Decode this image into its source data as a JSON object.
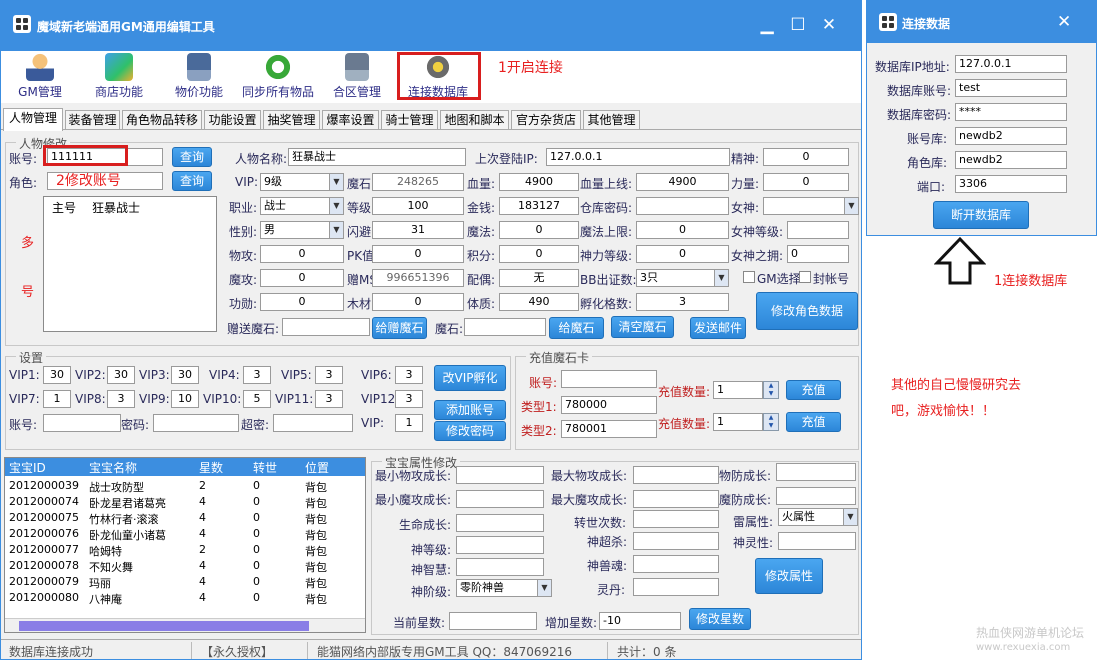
{
  "main_window": {
    "title": "魔域新老端通用GM通用编辑工具",
    "minimize": "▁",
    "maximize": "☐",
    "close": "✕"
  },
  "toolbar": {
    "items": [
      {
        "label": "GM管理",
        "icon": "gm-user-icon"
      },
      {
        "label": "商店功能",
        "icon": "shop-icon"
      },
      {
        "label": "物价功能",
        "icon": "price-icon"
      },
      {
        "label": "同步所有物品",
        "icon": "sync-icon"
      },
      {
        "label": "合区管理",
        "icon": "server-merge-icon"
      },
      {
        "label": "连接数据库",
        "icon": "database-connect-icon"
      }
    ],
    "annotation_open": "1开启连接"
  },
  "tabs": [
    "人物管理",
    "装备管理",
    "角色物品转移",
    "功能设置",
    "抽奖管理",
    "爆率设置",
    "骑士管理",
    "地图和脚本",
    "官方杂货店",
    "其他管理"
  ],
  "character": {
    "group_title": "人物修改",
    "account_label": "账号:",
    "account_value": "111111",
    "query1": "查询",
    "role_label": "角色:",
    "query2": "查询",
    "annotation_account": "2修改账号",
    "multi_label_1": "多",
    "multi_label_2": "号",
    "list_header_main": "主号",
    "list_header_name": "狂暴战士",
    "fields": {
      "name_label": "人物名称:",
      "name_value": "狂暴战士",
      "lastip_label": "上次登陆IP:",
      "lastip_value": "127.0.0.1",
      "spirit_label": "精神:",
      "spirit_value": "0",
      "vip_label": "VIP:",
      "vip_value": "9级",
      "magicstone_label": "魔石:",
      "magicstone_value": "248265",
      "hp_label": "血量:",
      "hp_value": "4900",
      "hpmax_label": "血量上线:",
      "hpmax_value": "4900",
      "power_label": "力量:",
      "power_value": "0",
      "job_label": "职业:",
      "job_value": "战士",
      "level_label": "等级:",
      "level_value": "100",
      "gold_label": "金钱:",
      "gold_value": "183127",
      "warehouse_label": "仓库密码:",
      "warehouse_value": "",
      "goddess_label": "女神:",
      "goddess_value": "",
      "gender_label": "性别:",
      "gender_value": "男",
      "dodge_label": "闪避:",
      "dodge_value": "31",
      "mana_label": "魔法:",
      "mana_value": "0",
      "manamax_label": "魔法上限:",
      "manamax_value": "0",
      "goddesslv_label": "女神等级:",
      "goddesslv_value": "",
      "pdef_label": "物攻:",
      "pdef_value": "0",
      "pk_label": "PK值:",
      "pk_value": "0",
      "points_label": "积分:",
      "points_value": "0",
      "godpower_label": "神力等级:",
      "godpower_value": "0",
      "goddesshug_label": "女神之拥:",
      "goddesshug_value": "0",
      "mattack_label": "魔攻:",
      "mattack_value": "0",
      "giftms_label": "赠MS:",
      "giftms_value": "996651396",
      "spouse_label": "配偶:",
      "spouse_value": "无",
      "bbcert_label": "BB出证数:",
      "bbcert_value": "3只",
      "gm_select": "GM选择",
      "ban_account": "封帐号",
      "merit_label": "功勋:",
      "merit_value": "0",
      "wood_label": "木材:",
      "wood_value": "0",
      "physique_label": "体质:",
      "physique_value": "490",
      "hatch_label": "孵化格数:",
      "hatch_value": "3",
      "modify_role": "修改角色数据",
      "gift_ms_label": "赠送魔石:",
      "gift_ms_value": "",
      "give_gift_ms": "给赠魔石",
      "ms_label": "魔石:",
      "ms_value": "",
      "give_ms": "给魔石",
      "clear_ms": "清空魔石",
      "send_mail": "发送邮件"
    }
  },
  "settings": {
    "group_title": "设置",
    "vips": [
      {
        "label": "VIP1:",
        "value": "30"
      },
      {
        "label": "VIP2:",
        "value": "30"
      },
      {
        "label": "VIP3:",
        "value": "30"
      },
      {
        "label": "VIP4:",
        "value": "3"
      },
      {
        "label": "VIP5:",
        "value": "3"
      },
      {
        "label": "VIP6:",
        "value": "3"
      },
      {
        "label": "VIP7:",
        "value": "1"
      },
      {
        "label": "VIP8:",
        "value": "3"
      },
      {
        "label": "VIP9:",
        "value": "10"
      },
      {
        "label": "VIP10:",
        "value": "5"
      },
      {
        "label": "VIP11:",
        "value": "3"
      },
      {
        "label": "VIP12",
        "value": "3"
      }
    ],
    "account_label": "账号:",
    "password_label": "密码:",
    "superpwd_label": "超密:",
    "vip_label": "VIP:",
    "vip_value": "1",
    "change_vip_hatch": "改VIP孵化",
    "add_account": "添加账号",
    "change_password": "修改密码"
  },
  "recharge": {
    "group_title": "充值魔石卡",
    "account_label": "账号:",
    "account_value": "",
    "type1_label": "类型1:",
    "type1_value": "780000",
    "type2_label": "类型2:",
    "type2_value": "780001",
    "qty1_label": "充值数量:",
    "qty1_value": "1",
    "qty2_label": "充值数量:",
    "qty2_value": "1",
    "recharge1": "充值",
    "recharge2": "充值"
  },
  "pet_table": {
    "headers": [
      "宝宝ID",
      "宝宝名称",
      "星数",
      "转世",
      "位置"
    ],
    "rows": [
      [
        "2012000039",
        "战士攻防型",
        "2",
        "0",
        "背包"
      ],
      [
        "2012000074",
        "卧龙星君诸葛亮",
        "4",
        "0",
        "背包"
      ],
      [
        "2012000075",
        "竹林行者·滚滚",
        "4",
        "0",
        "背包"
      ],
      [
        "2012000076",
        "卧龙仙童小诸葛",
        "4",
        "0",
        "背包"
      ],
      [
        "2012000077",
        "哈姆特",
        "2",
        "0",
        "背包"
      ],
      [
        "2012000078",
        "不知火舞",
        "4",
        "0",
        "背包"
      ],
      [
        "2012000079",
        "玛丽",
        "4",
        "0",
        "背包"
      ],
      [
        "2012000080",
        "八神庵",
        "4",
        "0",
        "背包"
      ]
    ]
  },
  "pet_attr": {
    "group_title": "宝宝属性修改",
    "min_patk": "最小物攻成长:",
    "max_patk": "最大物攻成长:",
    "pdef": "物防成长:",
    "min_matk": "最小魔攻成长:",
    "max_matk": "最大魔攻成长:",
    "mdef": "魔防成长:",
    "life": "生命成长:",
    "rebirth": "转世次数:",
    "thunder": "雷属性:",
    "element_value": "火属性",
    "god_level": "神等级:",
    "god_super": "神超杀:",
    "god_spirit": "神灵性:",
    "god_wisdom": "神智慧:",
    "god_soul": "神兽魂:",
    "god_stage": "神阶级:",
    "god_stage_value": "零阶神兽",
    "spirit_pill": "灵丹:",
    "modify_attr": "修改属性",
    "current_star": "当前星数:",
    "add_star": "增加星数:",
    "add_star_value": "-10",
    "modify_star": "修改星数"
  },
  "status_bar": {
    "db_status": "数据库连接成功",
    "license": "【永久授权】",
    "tool_info": "能猫网络内部版专用GM工具 QQ：847069216",
    "total": "共计：0 条"
  },
  "db_window": {
    "title": "连接数据",
    "close": "✕",
    "ip_label": "数据库IP地址:",
    "ip_value": "127.0.0.1",
    "user_label": "数据库账号:",
    "user_value": "test",
    "pass_label": "数据库密码:",
    "pass_value": "****",
    "acctdb_label": "账号库:",
    "acctdb_value": "newdb2",
    "roledb_label": "角色库:",
    "roledb_value": "newdb2",
    "port_label": "端口:",
    "port_value": "3306",
    "disconnect": "断开数据库"
  },
  "annotations": {
    "connect_db": "1连接数据库",
    "note_line1": "其他的自己慢慢研究去",
    "note_line2": "吧，游戏愉快！！"
  },
  "watermark": {
    "line1": "热血侠网游单机论坛",
    "line2": "www.rexuexia.com"
  },
  "colors": {
    "accent": "#3c8ee0",
    "button": "#2c86d8",
    "annotation": "#e82020",
    "grid_header": "#3c8ee0"
  }
}
